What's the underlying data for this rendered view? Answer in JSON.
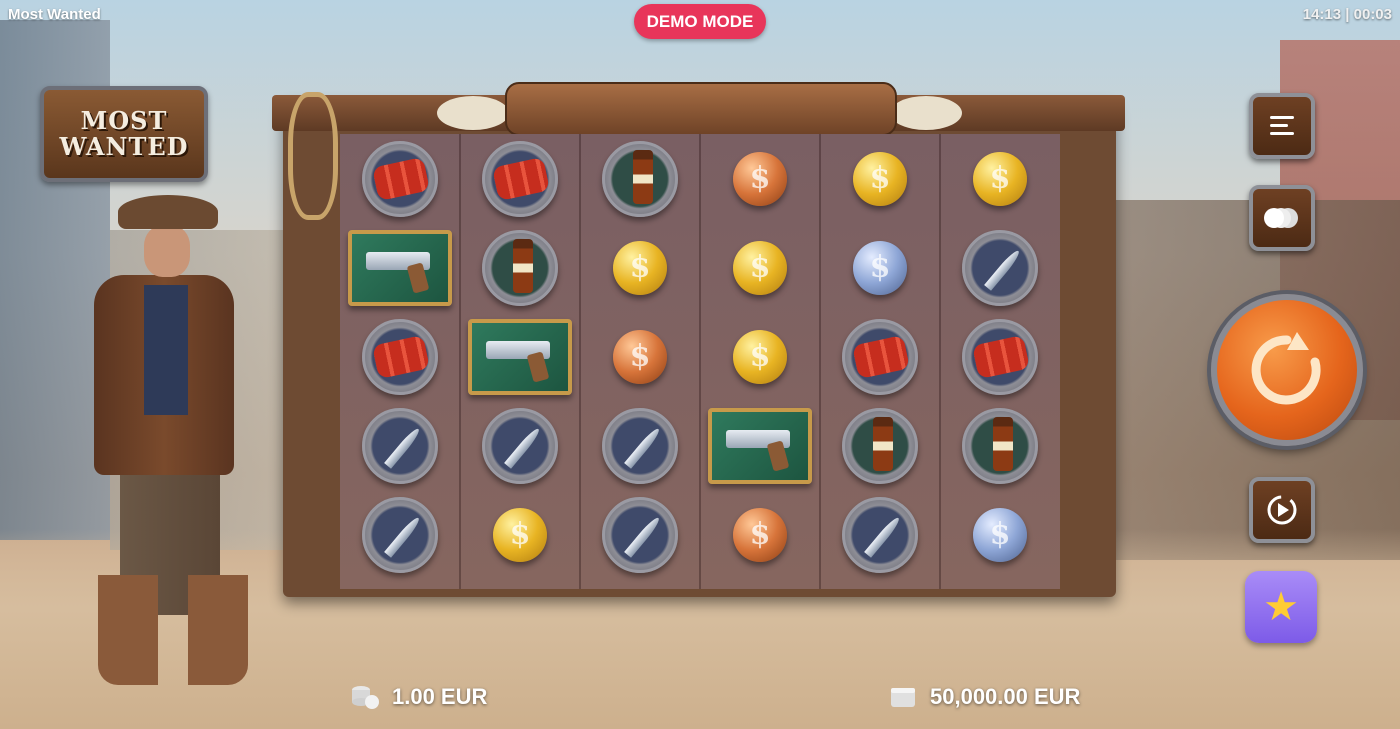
{
  "window": {
    "title": "Most Wanted",
    "clock": "14:13 | 00:03"
  },
  "badge": {
    "label": "DEMO MODE"
  },
  "logo": {
    "line1": "MOST",
    "line2": "WANTED"
  },
  "reels": {
    "symbols": [
      [
        "dynamite",
        "dynamite",
        "whiskey",
        "coin-bronze",
        "coin-gold",
        "coin-gold"
      ],
      [
        "revolver",
        "whiskey",
        "coin-gold",
        "coin-gold",
        "coin-silver",
        "knife"
      ],
      [
        "dynamite",
        "revolver",
        "coin-bronze",
        "coin-gold",
        "dynamite",
        "dynamite"
      ],
      [
        "knife",
        "knife",
        "knife",
        "revolver",
        "whiskey",
        "whiskey"
      ],
      [
        "knife",
        "coin-gold",
        "knife",
        "coin-bronze",
        "knife",
        "coin-silver"
      ]
    ]
  },
  "controls": {
    "menu_icon": "hamburger-menu-icon",
    "coins_icon": "bet-coins-icon",
    "spin_icon": "spin-arrow-icon",
    "autoplay_icon": "autoplay-icon",
    "feature_icon": "star-icon"
  },
  "bottom": {
    "bet": "1.00 EUR",
    "balance": "50,000.00 EUR"
  },
  "colors": {
    "demo_badge": "#e8355a",
    "spin": "#e5651c",
    "feature": "#8f6ff0"
  }
}
